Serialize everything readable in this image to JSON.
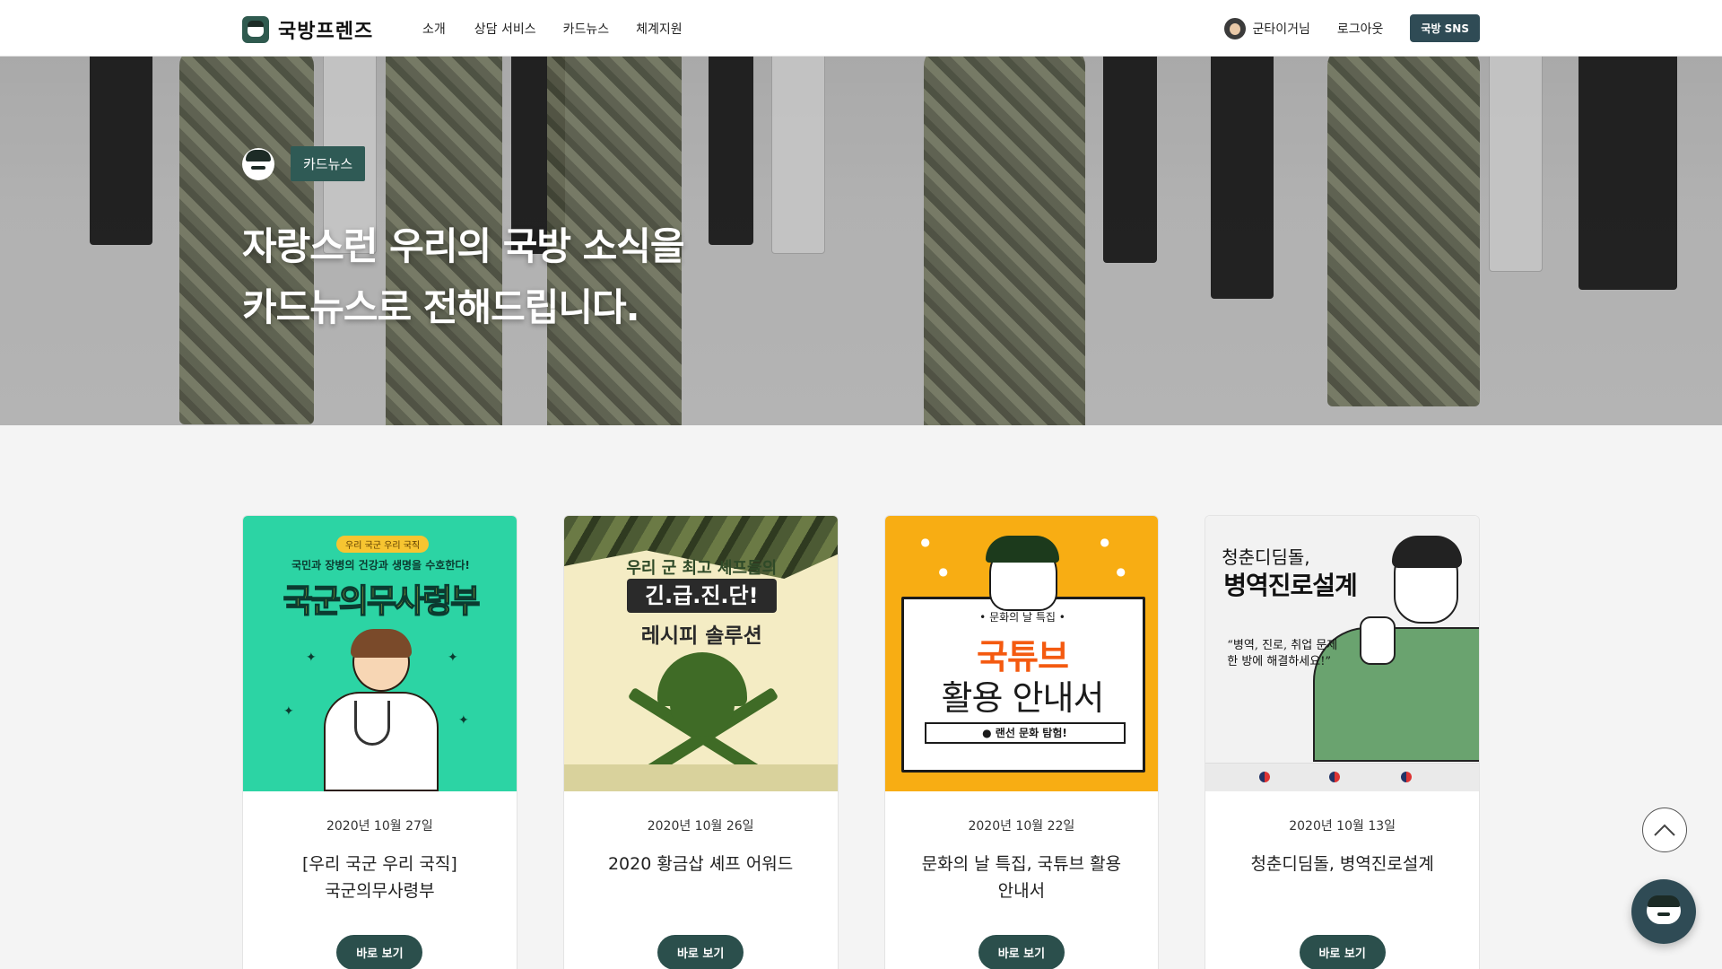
{
  "header": {
    "logo_text": "국방프렌즈",
    "nav": [
      {
        "label": "소개"
      },
      {
        "label": "상담 서비스"
      },
      {
        "label": "카드뉴스"
      },
      {
        "label": "체계지원"
      }
    ],
    "user_name": "군타이거님",
    "logout_label": "로그아웃",
    "sns_label": "국방 SNS"
  },
  "hero": {
    "tag": "카드뉴스",
    "title_line1": "자랑스런 우리의 국방 소식을",
    "title_line2": "카드뉴스로 전해드립니다."
  },
  "cards": [
    {
      "date": "2020년 10월 27일",
      "title_line1": "[우리 국군 우리 국직]",
      "title_line2": "국군의무사령부",
      "button": "바로 보기",
      "thumb": {
        "pill": "우리 국군 우리 국직",
        "subtitle": "국민과 장병의 건강과 생명을 수호한다!",
        "headline": "국군의무사령부"
      }
    },
    {
      "date": "2020년 10월 26일",
      "title_line1": "2020 황금삽 셰프 어워드",
      "title_line2": "",
      "button": "바로 보기",
      "thumb": {
        "line1": "우리 군 최고 셰프들의",
        "line2": "긴.급.진.단!",
        "line3": "레시피 솔루션"
      }
    },
    {
      "date": "2020년 10월 22일",
      "title_line1": "문화의 날 특집, 국튜브 활용",
      "title_line2": "안내서",
      "button": "바로 보기",
      "thumb": {
        "small": "• 문화의 날 특집 •",
        "big": "국튜브",
        "big2": "활용 안내서",
        "bar": "● 랜선 문화 탐험!"
      }
    },
    {
      "date": "2020년 10월 13일",
      "title_line1": "청춘디딤돌, 병역진로설계",
      "title_line2": "",
      "button": "바로 보기",
      "thumb": {
        "line1": "청춘디딤돌,",
        "line2": "병역진로설계",
        "quote1": "“병역, 진로, 취업 문제",
        "quote2": "한 방에 해결하세요!”"
      }
    }
  ],
  "colors": {
    "brand": "#2f5a4f",
    "button": "#2b4f4c",
    "sns": "#2f4b55"
  },
  "icons": {
    "logo": "chat-bubble-soldier-icon",
    "top": "chevron-up-icon",
    "chat": "chatbot-icon"
  }
}
